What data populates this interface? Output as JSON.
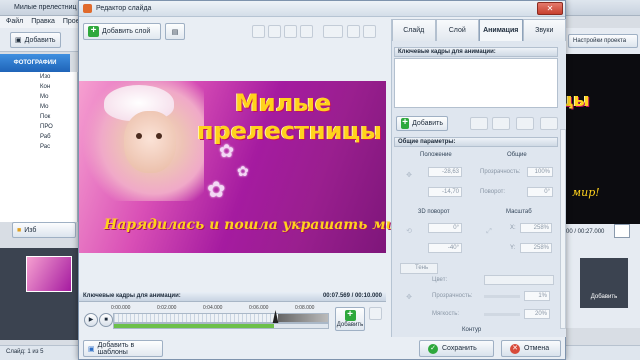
{
  "bg": {
    "title": "Милые прелестниц",
    "menu": [
      "Файл",
      "Правка",
      "Прое"
    ],
    "add_label": "Добавить",
    "photos_tab": "ФОТОГРАФИИ",
    "tree": [
      "Изо",
      "Кон",
      "Мо",
      "Мо",
      "Пок",
      "ПРО",
      "Раб",
      "Рас"
    ],
    "project_settings": "Настройки проекта",
    "templates_btn": "Изб",
    "time_label": "00 / 00:27.000",
    "right_add": "Добавить",
    "status": "Слайд: 1 из 5"
  },
  "dialog": {
    "title": "Редактор слайда",
    "add_layer": "Добавить слой",
    "tabs": [
      "Слайд",
      "Слой",
      "Анимация",
      "Звуки"
    ],
    "slide": {
      "title_line1": "Милые",
      "title_line2": "прелестницы",
      "subtitle": "Нарядилась и пошла украшать мир!"
    },
    "timeline": {
      "header": "Ключевые кадры для анимации:",
      "time": "00:07.569 / 00:10.000",
      "ticks": [
        "0:00.000",
        "0:02.000",
        "0:04.000",
        "0:06.000",
        "0:08.000"
      ],
      "add": "Добавить"
    },
    "add_templates": "Добавить в шаблоны",
    "save": "Сохранить",
    "cancel": "Отмена",
    "panel": {
      "keyframes": "Ключевые кадры для анимации:",
      "add": "Добавить",
      "general": "Общие параметры:",
      "position": "Положение",
      "common": "Общие",
      "pos_x": "-28,63",
      "pos_y": "-14,70",
      "transparency_label": "Прозрачность:",
      "transparency": "100%",
      "rotation_label": "Поворот:",
      "rotation": "0°",
      "rot3d": "3D поворот",
      "scale": "Масштаб",
      "rot3d_x": "0°",
      "rot3d_y": "-40°",
      "scale_x_label": "X:",
      "scale_x": "258%",
      "scale_y_label": "Y:",
      "scale_y": "258%",
      "shadow": "Тень",
      "color": "Цвет:",
      "opacity_label": "Прозрачность:",
      "opacity": "1%",
      "softness_label": "Мягкость:",
      "softness": "20%",
      "contour": "Контур"
    }
  }
}
